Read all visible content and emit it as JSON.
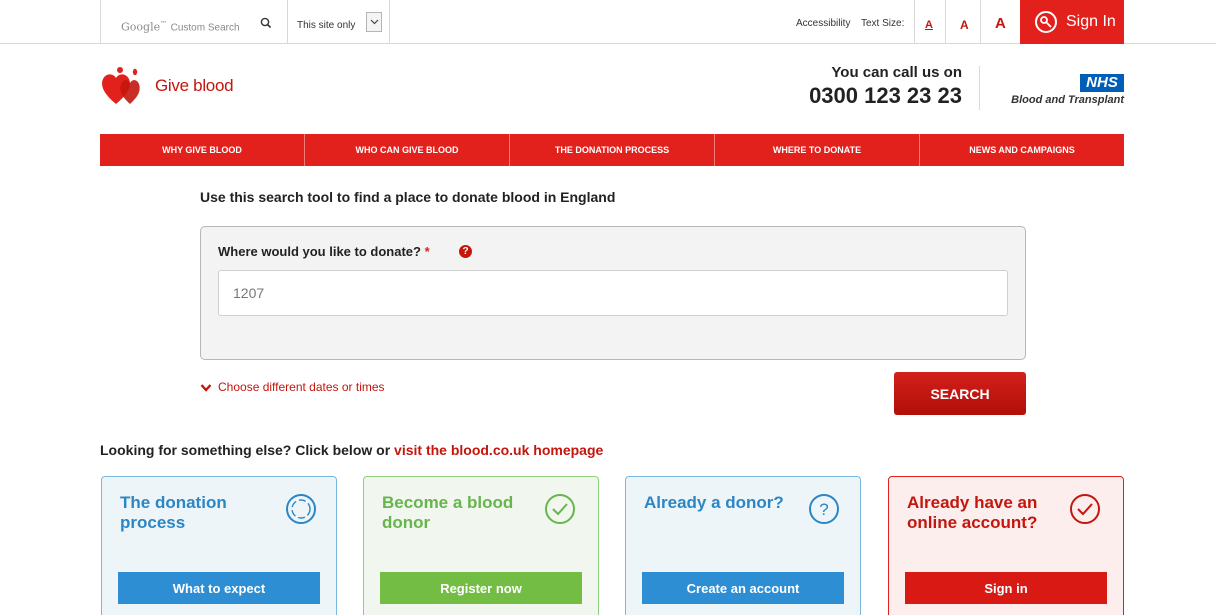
{
  "topbar": {
    "search_placeholder_brand": "Google",
    "search_placeholder_tm": "™",
    "search_placeholder_rest": "Custom Search",
    "site_select": "This site only",
    "accessibility": "Accessibility",
    "text_size": "Text Size:",
    "text_size_small": "A",
    "text_size_medium": "A",
    "text_size_large": "A",
    "sign_in": "Sign In"
  },
  "header": {
    "logo_text": "Give blood",
    "call_line1": "You can call us on",
    "call_number": "0300 123 23 23",
    "nhs_logo": "NHS",
    "nhs_sub": "Blood and Transplant"
  },
  "nav": {
    "items": [
      {
        "label": "WHY GIVE BLOOD"
      },
      {
        "label": "WHO CAN GIVE BLOOD"
      },
      {
        "label": "THE DONATION PROCESS"
      },
      {
        "label": "WHERE TO DONATE"
      },
      {
        "label": "NEWS AND CAMPAIGNS"
      }
    ]
  },
  "search": {
    "intro": "Use this search tool to find a place to donate blood in England",
    "field_label": "Where would you like to donate?",
    "required_mark": "*",
    "help_mark": "?",
    "field_value": "1207",
    "choose_dates": "Choose different dates or times",
    "search_button": "SEARCH"
  },
  "looking": {
    "text": "Looking for something else? Click below or ",
    "link": "visit the blood.co.uk homepage"
  },
  "cards": [
    {
      "title": "The donation process",
      "button": "What to expect",
      "icon": "circle-icon"
    },
    {
      "title": "Become a blood donor",
      "button": "Register now",
      "icon": "check-circle-icon"
    },
    {
      "title": "Already a donor?",
      "button": "Create an account",
      "icon": "question-circle-icon"
    },
    {
      "title": "Already have an online account?",
      "button": "Sign in",
      "icon": "check-circle-icon"
    }
  ],
  "colors": {
    "brand_red": "#e2211c",
    "blue": "#2e8ed4",
    "green": "#73bd45",
    "nhs_blue": "#005eb8"
  }
}
